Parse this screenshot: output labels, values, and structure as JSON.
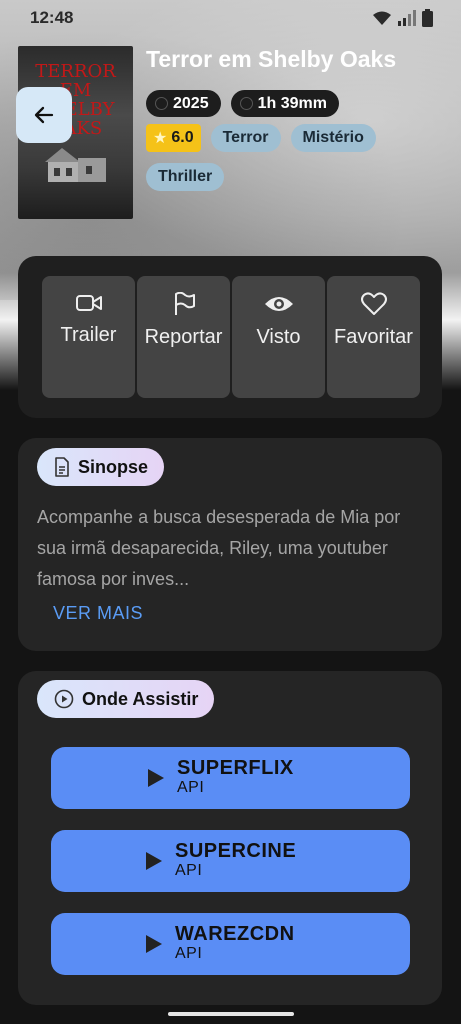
{
  "status_bar": {
    "time": "12:48"
  },
  "movie": {
    "poster_title": "TERROR EM SHELBY OAKS",
    "title": "Terror em Shelby Oaks",
    "year": "2025",
    "duration": "1h 39mm",
    "rating": "6.0",
    "genres": [
      "Terror",
      "Mistério",
      "Thriller"
    ]
  },
  "actions": [
    {
      "label": "Trailer",
      "icon": "video-icon"
    },
    {
      "label": "Reportar",
      "icon": "flag-icon"
    },
    {
      "label": "Visto",
      "icon": "eye-icon"
    },
    {
      "label": "Favoritar",
      "icon": "heart-icon"
    }
  ],
  "synopsis": {
    "heading": "Sinopse",
    "text": "Acompanhe a busca desesperada de Mia por sua irmã desaparecida, Riley, uma youtuber famosa por inves...",
    "more_label": "VER MAIS"
  },
  "watch": {
    "heading": "Onde Assistir",
    "providers": [
      {
        "name": "SUPERFLIX",
        "sub": "API"
      },
      {
        "name": "SUPERCINE",
        "sub": "API"
      },
      {
        "name": "WAREZCDN",
        "sub": "API"
      }
    ]
  },
  "colors": {
    "accent_blue": "#5a8df5",
    "rating_yellow": "#f5c218",
    "genre_chip": "#9fbfd2",
    "card_bg": "#252525"
  }
}
